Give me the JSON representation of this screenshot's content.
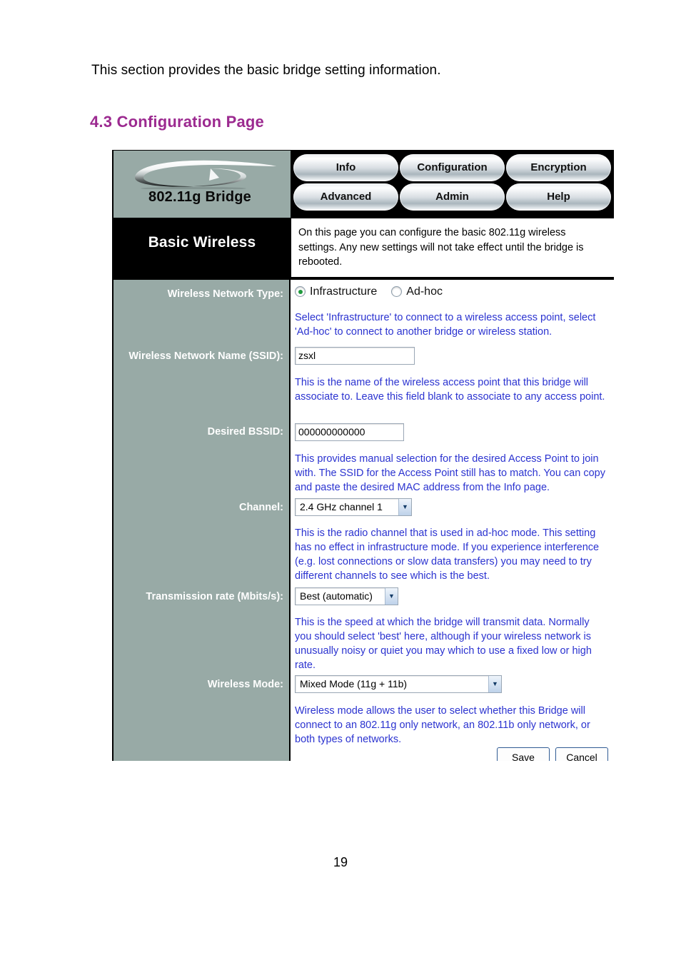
{
  "document": {
    "intro_text": "This section provides the basic bridge setting information.",
    "heading": "4.3 Configuration Page",
    "page_number": "19"
  },
  "screenshot": {
    "brand": {
      "name": "802.11g Bridge",
      "logo_icon": "oval-swoosh-logo"
    },
    "nav": {
      "row1": [
        "Info",
        "Configuration",
        "Encryption"
      ],
      "row2": [
        "Advanced",
        "Admin",
        "Help"
      ]
    },
    "page": {
      "title": "Basic Wireless",
      "description": "On this page you can configure the basic 802.11g wireless settings. Any new settings will not take effect until the bridge is rebooted."
    },
    "fields": {
      "network_type": {
        "label": "Wireless Network Type:",
        "options": [
          "Infrastructure",
          "Ad-hoc"
        ],
        "selected": "Infrastructure",
        "help": "Select 'Infrastructure' to connect to a wireless access point, select 'Ad-hoc' to connect to another bridge or wireless station."
      },
      "ssid": {
        "label": "Wireless Network Name (SSID):",
        "value": "zsxl",
        "help": "This is the name of the wireless access point that this bridge will associate to. Leave this field blank to associate to any access point."
      },
      "bssid": {
        "label": "Desired BSSID:",
        "value": "000000000000",
        "help": "This provides manual selection for the desired Access Point to join with. The SSID for the Access Point still has to match. You can copy and paste the desired MAC address from the Info page."
      },
      "channel": {
        "label": "Channel:",
        "value": "2.4 GHz channel 1",
        "help": "This is the radio channel that is used in ad-hoc mode. This setting has no effect in infrastructure mode. If you experience interference (e.g. lost connections or slow data transfers) you may need to try different channels to see which is the best."
      },
      "tx_rate": {
        "label": "Transmission rate (Mbits/s):",
        "value": "Best (automatic)",
        "help": "This is the speed at which the bridge will transmit data. Normally you should select 'best' here, although if your wireless network is unusually noisy or quiet you may which to use a fixed low or high rate."
      },
      "wireless_mode": {
        "label": "Wireless Mode:",
        "value": "Mixed Mode (11g + 11b)",
        "help": "Wireless mode allows the user to select whether this Bridge will connect to an 802.11g only network, an 802.11b only network, or both types of networks."
      }
    },
    "actions": {
      "save": "Save",
      "cancel": "Cancel"
    },
    "colors": {
      "sidebar": "#98aaa6",
      "help_text": "#2b33d0",
      "heading": "#9c2a90",
      "radio_dot": "#1f9a3d"
    }
  }
}
